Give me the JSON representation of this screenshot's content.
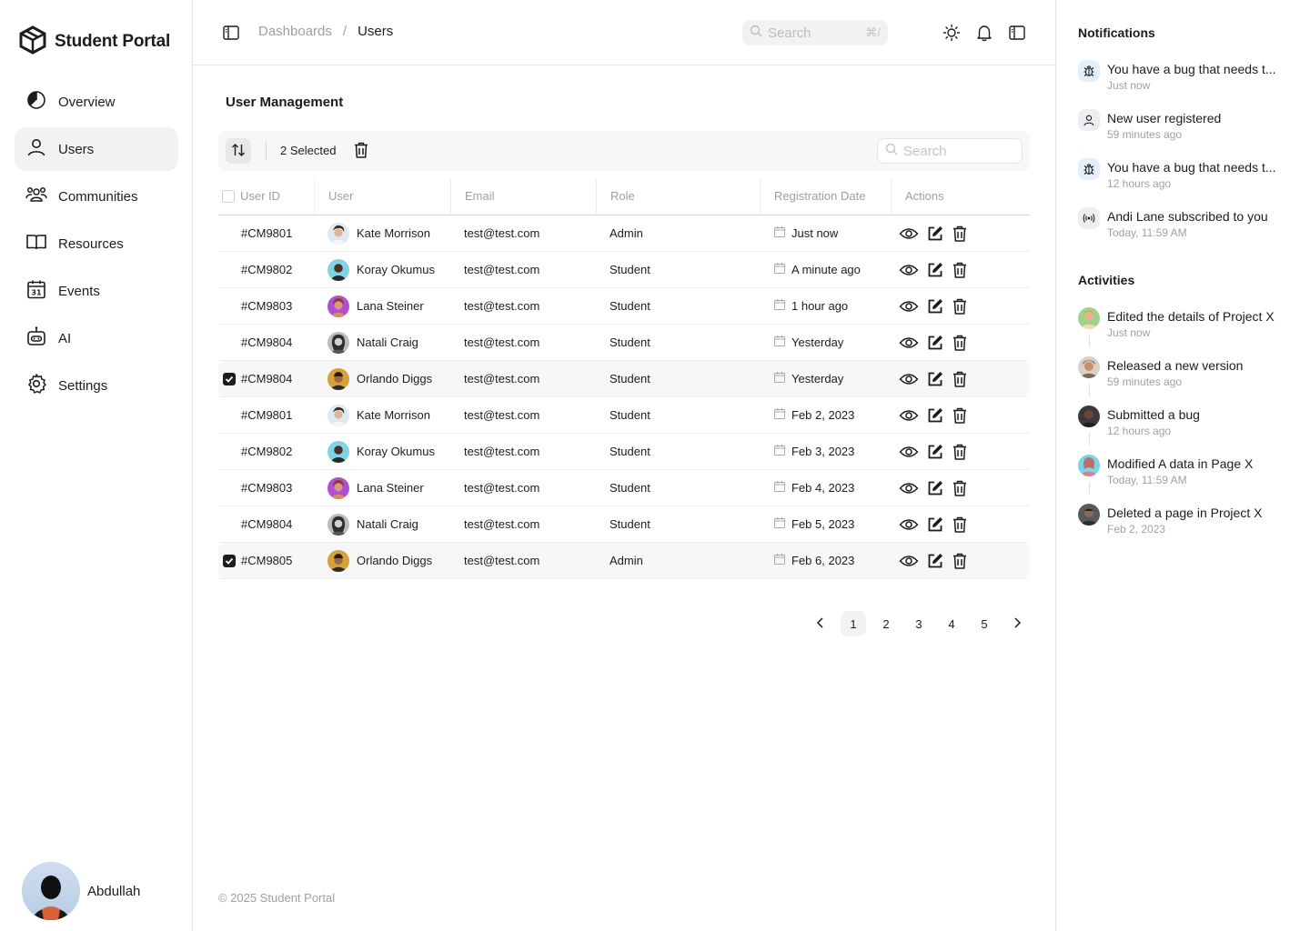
{
  "app": {
    "name": "Student Portal",
    "copyright": "© 2025 Student Portal"
  },
  "sidebar": {
    "items": [
      {
        "label": "Overview",
        "icon": "pie-chart-icon"
      },
      {
        "label": "Users",
        "icon": "user-icon",
        "active": true
      },
      {
        "label": "Communities",
        "icon": "users-group-icon"
      },
      {
        "label": "Resources",
        "icon": "book-open-icon"
      },
      {
        "label": "Events",
        "icon": "calendar-icon"
      },
      {
        "label": "AI",
        "icon": "robot-icon"
      },
      {
        "label": "Settings",
        "icon": "gear-icon"
      }
    ],
    "profile_name": "Abdullah"
  },
  "topbar": {
    "breadcrumb_parent": "Dashboards",
    "breadcrumb_sep": "/",
    "breadcrumb_current": "Users",
    "search_placeholder": "Search",
    "search_shortcut": "⌘/"
  },
  "page": {
    "title": "User Management",
    "selected_text": "2 Selected",
    "table_search_placeholder": "Search"
  },
  "table": {
    "headers": [
      "User ID",
      "User",
      "Email",
      "Role",
      "Registration Date",
      "Actions"
    ],
    "rows": [
      {
        "id": "#CM9801",
        "user": "Kate Morrison",
        "email": "test@test.com",
        "role": "Admin",
        "date": "Just now",
        "selected": false
      },
      {
        "id": "#CM9802",
        "user": "Koray Okumus",
        "email": "test@test.com",
        "role": "Student",
        "date": "A minute ago",
        "selected": false
      },
      {
        "id": "#CM9803",
        "user": "Lana Steiner",
        "email": "test@test.com",
        "role": "Student",
        "date": "1 hour ago",
        "selected": false
      },
      {
        "id": "#CM9804",
        "user": "Natali Craig",
        "email": "test@test.com",
        "role": "Student",
        "date": "Yesterday",
        "selected": false
      },
      {
        "id": "#CM9804",
        "user": "Orlando Diggs",
        "email": "test@test.com",
        "role": "Student",
        "date": "Yesterday",
        "selected": true
      },
      {
        "id": "#CM9801",
        "user": "Kate Morrison",
        "email": "test@test.com",
        "role": "Student",
        "date": "Feb 2, 2023",
        "selected": false
      },
      {
        "id": "#CM9802",
        "user": "Koray Okumus",
        "email": "test@test.com",
        "role": "Student",
        "date": "Feb 3, 2023",
        "selected": false
      },
      {
        "id": "#CM9803",
        "user": "Lana Steiner",
        "email": "test@test.com",
        "role": "Student",
        "date": "Feb 4, 2023",
        "selected": false
      },
      {
        "id": "#CM9804",
        "user": "Natali Craig",
        "email": "test@test.com",
        "role": "Student",
        "date": "Feb 5, 2023",
        "selected": false
      },
      {
        "id": "#CM9805",
        "user": "Orlando Diggs",
        "email": "test@test.com",
        "role": "Admin",
        "date": "Feb 6, 2023",
        "selected": true
      }
    ]
  },
  "pagination": {
    "pages": [
      "1",
      "2",
      "3",
      "4",
      "5"
    ],
    "current": "1"
  },
  "notifications": {
    "title": "Notifications",
    "items": [
      {
        "text": "You have a bug that needs t...",
        "time": "Just now",
        "icon": "bug-icon"
      },
      {
        "text": "New user registered",
        "time": "59 minutes ago",
        "icon": "user-icon"
      },
      {
        "text": "You have a bug that needs t...",
        "time": "12 hours ago",
        "icon": "bug-icon"
      },
      {
        "text": "Andi Lane subscribed to you",
        "time": "Today, 11:59 AM",
        "icon": "broadcast-icon"
      }
    ]
  },
  "activities": {
    "title": "Activities",
    "items": [
      {
        "text": "Edited the details of Project X",
        "time": "Just now"
      },
      {
        "text": "Released a new version",
        "time": "59 minutes ago"
      },
      {
        "text": "Submitted a bug",
        "time": "12 hours ago"
      },
      {
        "text": "Modified A data in Page X",
        "time": "Today, 11:59 AM"
      },
      {
        "text": "Deleted a page in Project X",
        "time": "Feb 2, 2023"
      }
    ]
  },
  "colors": {
    "text": "#1c1c1c",
    "muted": "#a0a0a0",
    "active_bg": "#f2f2f2",
    "notif_icon_bg": "#e3f0fb"
  }
}
